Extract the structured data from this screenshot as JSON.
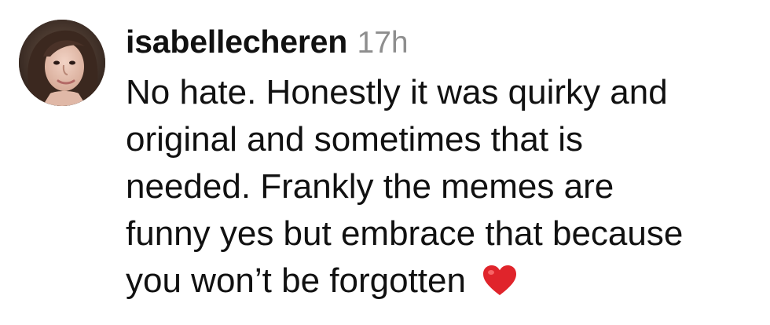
{
  "comment": {
    "username": "isabellecheren",
    "timestamp": "17h",
    "text_lines": [
      "No hate. Honestly it was quirky and",
      "original and sometimes that is",
      "needed. Frankly the memes are",
      "funny yes but embrace that because",
      "you won’t be forgotten"
    ],
    "emoji": "heart-icon",
    "colors": {
      "username": "#111111",
      "timestamp": "#8e8e8e",
      "text": "#111111",
      "heart": "#e0242b"
    }
  }
}
